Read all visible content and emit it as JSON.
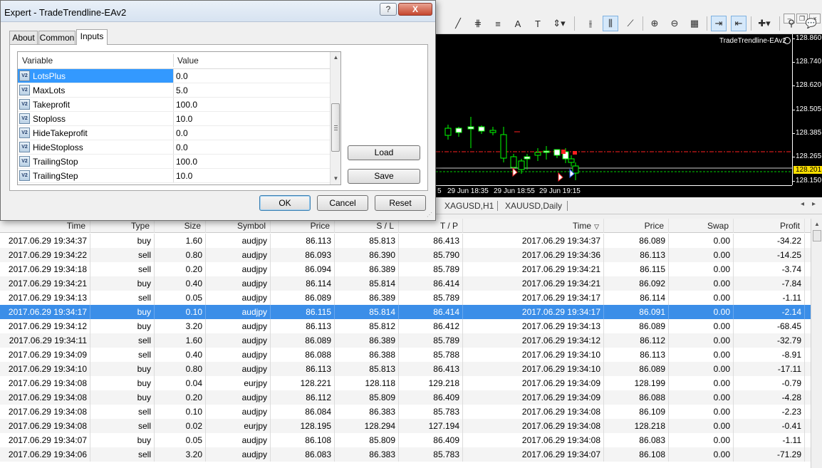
{
  "dialog": {
    "title": "Expert - TradeTrendline-EAv2",
    "help_label": "?",
    "close_label": "X",
    "tabs": [
      {
        "label": "About"
      },
      {
        "label": "Common"
      },
      {
        "label": "Inputs"
      }
    ],
    "params_header": {
      "variable": "Variable",
      "value": "Value"
    },
    "param_icon_text": "V2",
    "params": [
      {
        "name": "LotsPlus",
        "value": "0.0"
      },
      {
        "name": "MaxLots",
        "value": "5.0"
      },
      {
        "name": "Takeprofit",
        "value": "100.0"
      },
      {
        "name": "Stoploss",
        "value": "10.0"
      },
      {
        "name": "HideTakeprofit",
        "value": "0.0"
      },
      {
        "name": "HideStoploss",
        "value": "0.0"
      },
      {
        "name": "TrailingStop",
        "value": "100.0"
      },
      {
        "name": "TrailingStep",
        "value": "10.0"
      }
    ],
    "load_label": "Load",
    "save_label": "Save",
    "ok_label": "OK",
    "cancel_label": "Cancel",
    "reset_label": "Reset"
  },
  "chart": {
    "title": "TradeTrendline-EAv2",
    "price_labels": [
      "128.860",
      "128.740",
      "128.620",
      "128.505",
      "128.385",
      "128.265",
      "128.150"
    ],
    "current_price": "128.201",
    "time_labels": [
      "5",
      "29 Jun 18:35",
      "29 Jun 18:55",
      "29 Jun 19:15"
    ]
  },
  "chart_tabs": [
    "XAGUSD,H1",
    "XAUUSD,Daily"
  ],
  "table": {
    "columns": [
      "Time",
      "Type",
      "Size",
      "Symbol",
      "Price",
      "S / L",
      "T / P",
      "Time",
      "Price",
      "Swap",
      "Profit"
    ],
    "sort_indicator": "▽",
    "selected_row": 5,
    "rows": [
      [
        "2017.06.29 19:34:37",
        "buy",
        "1.60",
        "audjpy",
        "86.113",
        "85.813",
        "86.413",
        "2017.06.29 19:34:37",
        "86.089",
        "0.00",
        "-34.22"
      ],
      [
        "2017.06.29 19:34:22",
        "sell",
        "0.80",
        "audjpy",
        "86.093",
        "86.390",
        "85.790",
        "2017.06.29 19:34:36",
        "86.113",
        "0.00",
        "-14.25"
      ],
      [
        "2017.06.29 19:34:18",
        "sell",
        "0.20",
        "audjpy",
        "86.094",
        "86.389",
        "85.789",
        "2017.06.29 19:34:21",
        "86.115",
        "0.00",
        "-3.74"
      ],
      [
        "2017.06.29 19:34:21",
        "buy",
        "0.40",
        "audjpy",
        "86.114",
        "85.814",
        "86.414",
        "2017.06.29 19:34:21",
        "86.092",
        "0.00",
        "-7.84"
      ],
      [
        "2017.06.29 19:34:13",
        "sell",
        "0.05",
        "audjpy",
        "86.089",
        "86.389",
        "85.789",
        "2017.06.29 19:34:17",
        "86.114",
        "0.00",
        "-1.11"
      ],
      [
        "2017.06.29 19:34:17",
        "buy",
        "0.10",
        "audjpy",
        "86.115",
        "85.814",
        "86.414",
        "2017.06.29 19:34:17",
        "86.091",
        "0.00",
        "-2.14"
      ],
      [
        "2017.06.29 19:34:12",
        "buy",
        "3.20",
        "audjpy",
        "86.113",
        "85.812",
        "86.412",
        "2017.06.29 19:34:13",
        "86.089",
        "0.00",
        "-68.45"
      ],
      [
        "2017.06.29 19:34:11",
        "sell",
        "1.60",
        "audjpy",
        "86.089",
        "86.389",
        "85.789",
        "2017.06.29 19:34:12",
        "86.112",
        "0.00",
        "-32.79"
      ],
      [
        "2017.06.29 19:34:09",
        "sell",
        "0.40",
        "audjpy",
        "86.088",
        "86.388",
        "85.788",
        "2017.06.29 19:34:10",
        "86.113",
        "0.00",
        "-8.91"
      ],
      [
        "2017.06.29 19:34:10",
        "buy",
        "0.80",
        "audjpy",
        "86.113",
        "85.813",
        "86.413",
        "2017.06.29 19:34:10",
        "86.089",
        "0.00",
        "-17.11"
      ],
      [
        "2017.06.29 19:34:08",
        "buy",
        "0.04",
        "eurjpy",
        "128.221",
        "128.118",
        "129.218",
        "2017.06.29 19:34:09",
        "128.199",
        "0.00",
        "-0.79"
      ],
      [
        "2017.06.29 19:34:08",
        "buy",
        "0.20",
        "audjpy",
        "86.112",
        "85.809",
        "86.409",
        "2017.06.29 19:34:09",
        "86.088",
        "0.00",
        "-4.28"
      ],
      [
        "2017.06.29 19:34:08",
        "sell",
        "0.10",
        "audjpy",
        "86.084",
        "86.383",
        "85.783",
        "2017.06.29 19:34:08",
        "86.109",
        "0.00",
        "-2.23"
      ],
      [
        "2017.06.29 19:34:08",
        "sell",
        "0.02",
        "eurjpy",
        "128.195",
        "128.294",
        "127.194",
        "2017.06.29 19:34:08",
        "128.218",
        "0.00",
        "-0.41"
      ],
      [
        "2017.06.29 19:34:07",
        "buy",
        "0.05",
        "audjpy",
        "86.108",
        "85.809",
        "86.409",
        "2017.06.29 19:34:08",
        "86.083",
        "0.00",
        "-1.11"
      ],
      [
        "2017.06.29 19:34:06",
        "sell",
        "3.20",
        "audjpy",
        "86.083",
        "86.383",
        "85.783",
        "2017.06.29 19:34:07",
        "86.108",
        "0.00",
        "-71.29"
      ]
    ]
  },
  "colors": {
    "selection": "#3b8ee8",
    "chart_bg": "#000000",
    "bull_candle": "#ffffff",
    "stop_line": "#ff0000",
    "bid_line": "#00cc00",
    "current_price_bg": "#ffe000"
  }
}
